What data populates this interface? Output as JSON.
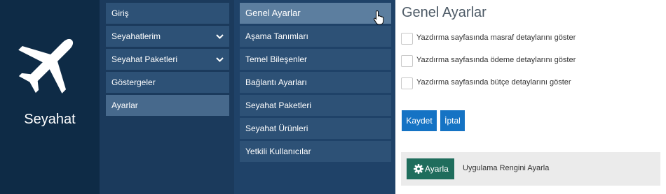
{
  "brand": {
    "name": "Seyahat",
    "icon": "airplane-icon"
  },
  "menu1": {
    "items": [
      {
        "label": "Giriş",
        "chevron": false
      },
      {
        "label": "Seyahatlerim",
        "chevron": true
      },
      {
        "label": "Seyahat Paketleri",
        "chevron": true
      },
      {
        "label": "Göstergeler",
        "chevron": false
      },
      {
        "label": "Ayarlar",
        "chevron": false,
        "active": true
      }
    ],
    "chevron_glyph": "⌄"
  },
  "menu2": {
    "items": [
      {
        "label": "Genel Ayarlar",
        "active": true
      },
      {
        "label": "Aşama Tanımları"
      },
      {
        "label": "Temel Bileşenler"
      },
      {
        "label": "Bağlantı Ayarları"
      },
      {
        "label": "Seyahat Paketleri"
      },
      {
        "label": "Seyahat Ürünleri"
      },
      {
        "label": "Yetkili Kullanıcılar"
      }
    ]
  },
  "content": {
    "title": "Genel Ayarlar",
    "checkboxes": [
      {
        "label": "Yazdırma sayfasında masraf detaylarını göster",
        "checked": false
      },
      {
        "label": "Yazdırma sayfasında ödeme detaylarını göster",
        "checked": false
      },
      {
        "label": "Yazdırma sayfasında bütçe detaylarını göster",
        "checked": false
      }
    ],
    "save_label": "Kaydet",
    "cancel_label": "İptal",
    "theme_panel": {
      "button_label": "Ayarla",
      "button_icon": "gear-icon",
      "text": "Uygulama Rengini Ayarla"
    }
  },
  "colors": {
    "brand_bg": "#0e2b46",
    "menu1_bg": "#1b3a5c",
    "menu2_bg": "#1f4268",
    "primary_button": "#1573c4",
    "ayarla_button": "#1f6d5c"
  }
}
